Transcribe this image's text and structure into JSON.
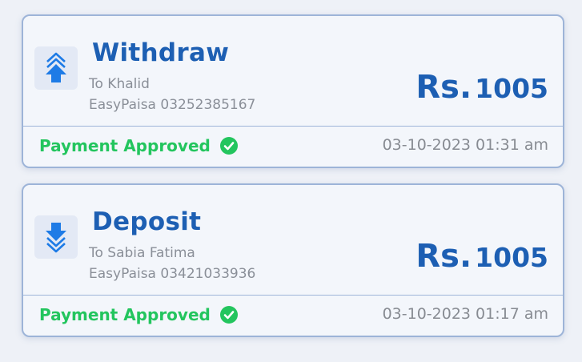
{
  "transactions": [
    {
      "type_label": "Withdraw",
      "direction_icon": "arrow-up-icon",
      "to_line": "To Khalid",
      "account_line": "EasyPaisa 03252385167",
      "currency": "Rs.",
      "amount": "1005",
      "status": "Payment Approved",
      "datetime": "03-10-2023 01:31 am"
    },
    {
      "type_label": "Deposit",
      "direction_icon": "arrow-down-icon",
      "to_line": "To Sabia Fatima",
      "account_line": "EasyPaisa 03421033936",
      "currency": "Rs.",
      "amount": "1005",
      "status": "Payment Approved",
      "datetime": "03-10-2023 01:17 am"
    }
  ],
  "colors": {
    "accent": "#1d5fb3",
    "icon_blue": "#1e7be6",
    "approved_green": "#23c55e",
    "border": "#9db4d8",
    "muted_text": "#8a8f98"
  }
}
